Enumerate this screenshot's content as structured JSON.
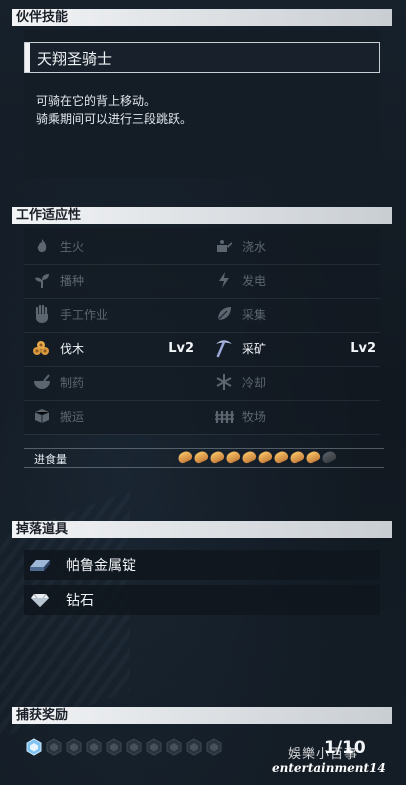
{
  "partner_skill": {
    "header": "伙伴技能",
    "name": "天翔圣骑士",
    "desc_line1": "可骑在它的背上移动。",
    "desc_line2": "骑乘期间可以进行三段跳跃。"
  },
  "work_suitability": {
    "header": "工作适应性",
    "items": [
      {
        "label": "生火",
        "icon": "fire-icon",
        "active": false,
        "level": ""
      },
      {
        "label": "浇水",
        "icon": "watering-icon",
        "active": false,
        "level": ""
      },
      {
        "label": "播种",
        "icon": "sprout-icon",
        "active": false,
        "level": ""
      },
      {
        "label": "发电",
        "icon": "lightning-icon",
        "active": false,
        "level": ""
      },
      {
        "label": "手工作业",
        "icon": "hand-icon",
        "active": false,
        "level": ""
      },
      {
        "label": "采集",
        "icon": "leaf-icon",
        "active": false,
        "level": ""
      },
      {
        "label": "伐木",
        "icon": "logs-icon",
        "active": true,
        "level": "Lv2"
      },
      {
        "label": "采矿",
        "icon": "pickaxe-icon",
        "active": true,
        "level": "Lv2"
      },
      {
        "label": "制药",
        "icon": "bowl-icon",
        "active": false,
        "level": ""
      },
      {
        "label": "冷却",
        "icon": "snowflake-icon",
        "active": false,
        "level": ""
      },
      {
        "label": "搬运",
        "icon": "box-icon",
        "active": false,
        "level": ""
      },
      {
        "label": "牧场",
        "icon": "fence-icon",
        "active": false,
        "level": ""
      }
    ],
    "food_label": "进食量",
    "food_filled": 9,
    "food_total": 10
  },
  "drops": {
    "header": "掉落道具",
    "items": [
      {
        "label": "帕鲁金属锭",
        "icon": "ingot-icon"
      },
      {
        "label": "钻石",
        "icon": "diamond-icon"
      }
    ]
  },
  "capture_reward": {
    "header": "捕获奖励",
    "page": "1/10",
    "slots_total": 10,
    "slots_active": 1
  },
  "watermark": {
    "line1": "娛樂小百事",
    "line2": "entertainment14"
  }
}
